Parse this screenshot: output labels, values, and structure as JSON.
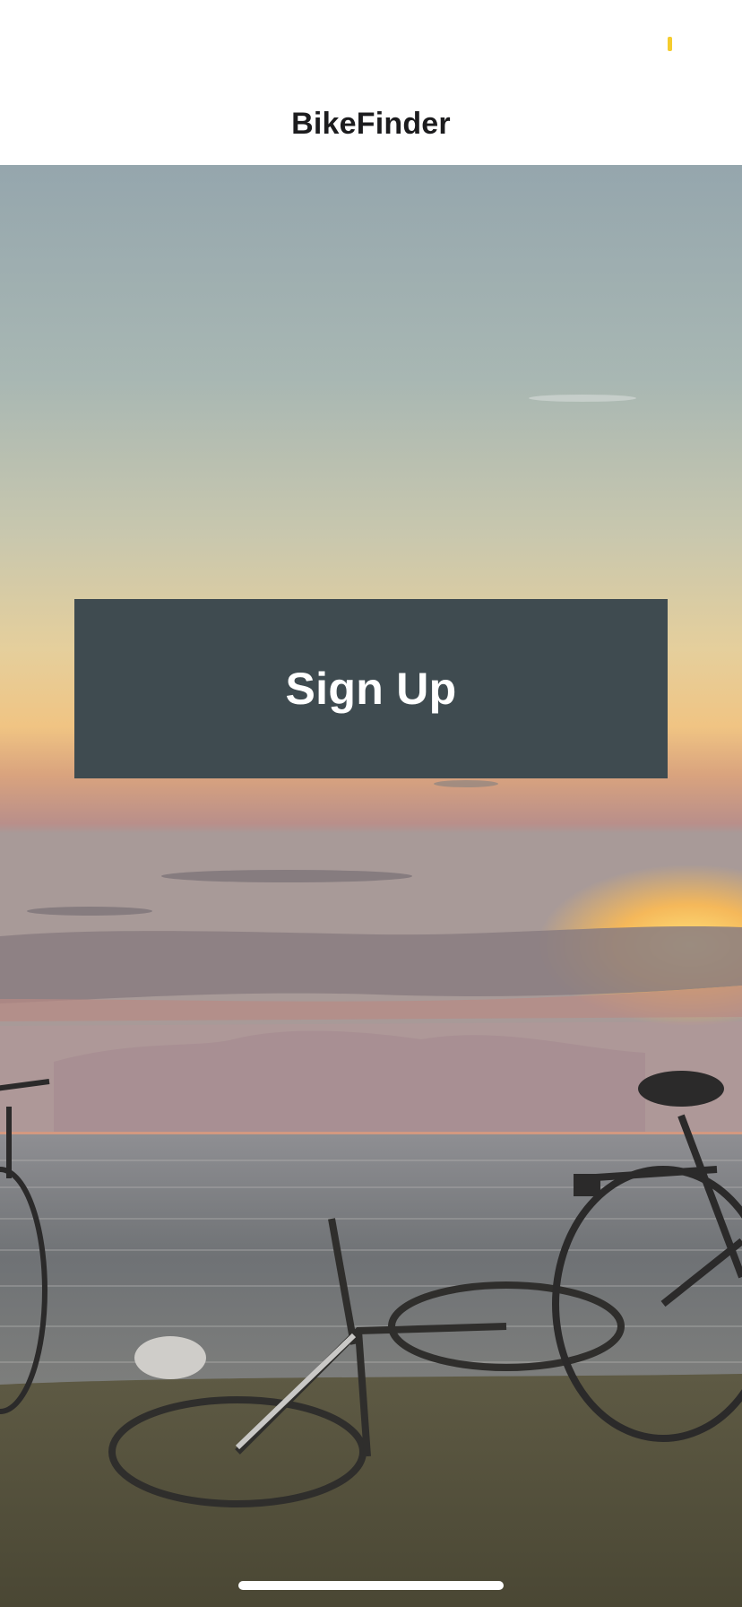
{
  "status_bar": {
    "battery_color": "#f5cc2e"
  },
  "nav": {
    "title": "BikeFinder"
  },
  "main": {
    "signup_label": "Sign Up",
    "background": "sunset-beach-bicycles-photo"
  },
  "colors": {
    "button": "#3f4b50",
    "title": "#1c1c1e"
  }
}
